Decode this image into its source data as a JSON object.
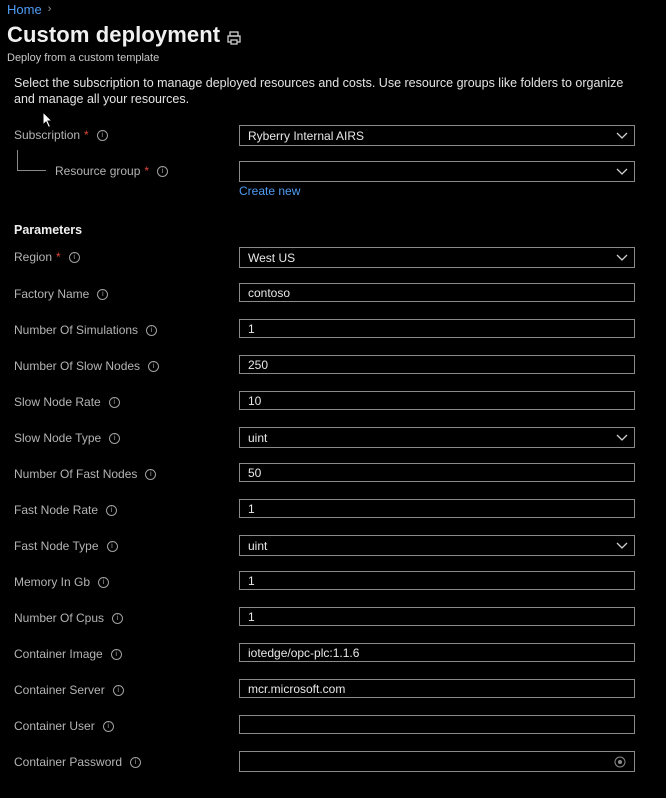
{
  "breadcrumb": {
    "home": "Home"
  },
  "header": {
    "title": "Custom deployment",
    "subtitle": "Deploy from a custom template",
    "print_icon": "print-icon"
  },
  "intro": "Select the subscription to manage deployed resources and costs. Use resource groups like folders to organize and manage all your resources.",
  "subscription": {
    "label": "Subscription",
    "value": "Ryberry Internal AIRS"
  },
  "resource_group": {
    "label": "Resource group",
    "value": "",
    "create_new": "Create new"
  },
  "parameters": {
    "heading": "Parameters",
    "region": {
      "label": "Region",
      "value": "West US"
    },
    "factory_name": {
      "label": "Factory Name",
      "value": "contoso"
    },
    "number_of_simulations": {
      "label": "Number Of Simulations",
      "value": "1"
    },
    "number_of_slow_nodes": {
      "label": "Number Of Slow Nodes",
      "value": "250"
    },
    "slow_node_rate": {
      "label": "Slow Node Rate",
      "value": "10"
    },
    "slow_node_type": {
      "label": "Slow Node Type",
      "value": "uint"
    },
    "number_of_fast_nodes": {
      "label": "Number Of Fast Nodes",
      "value": "50"
    },
    "fast_node_rate": {
      "label": "Fast Node Rate",
      "value": "1"
    },
    "fast_node_type": {
      "label": "Fast Node Type",
      "value": "uint"
    },
    "memory_in_gb": {
      "label": "Memory In Gb",
      "value": "1"
    },
    "number_of_cpus": {
      "label": "Number Of Cpus",
      "value": "1"
    },
    "container_image": {
      "label": "Container Image",
      "value": "iotedge/opc-plc:1.1.6"
    },
    "container_server": {
      "label": "Container Server",
      "value": "mcr.microsoft.com"
    },
    "container_user": {
      "label": "Container User",
      "value": ""
    },
    "container_password": {
      "label": "Container Password",
      "value": ""
    }
  },
  "required_marker": "*",
  "info_glyph": "i",
  "colors": {
    "accent": "#4f9cf4",
    "required": "#e0453a",
    "background": "#000000"
  }
}
